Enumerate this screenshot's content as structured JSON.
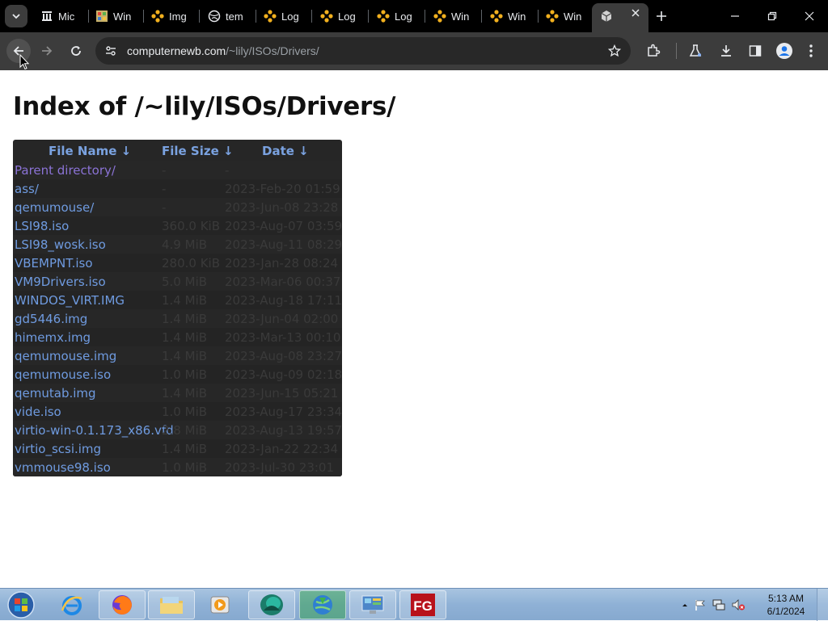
{
  "browser": {
    "tabs": [
      {
        "label": "Mic",
        "icon": "microsoft-columns-icon"
      },
      {
        "label": "Win",
        "icon": "windows-flag-icon"
      },
      {
        "label": "Img",
        "icon": "flower-icon"
      },
      {
        "label": "tem",
        "icon": "globe-icon"
      },
      {
        "label": "Log",
        "icon": "flower-icon"
      },
      {
        "label": "Log",
        "icon": "flower-icon"
      },
      {
        "label": "Log",
        "icon": "flower-icon"
      },
      {
        "label": "Win",
        "icon": "flower-icon"
      },
      {
        "label": "Win",
        "icon": "flower-icon"
      },
      {
        "label": "Win",
        "icon": "flower-icon"
      }
    ],
    "active_tab_icon": "cube-icon",
    "url_host": "computernewb.com",
    "url_path": "/~lily/ISOs/Drivers/"
  },
  "page": {
    "title": "Index of /~lily/ISOs/Drivers/",
    "columns": {
      "name": "File Name  ↓",
      "size": "File Size  ↓",
      "date": "Date  ↓"
    },
    "files": [
      {
        "name": "Parent directory/",
        "size": "-",
        "date": "-"
      },
      {
        "name": "ass/",
        "size": "-",
        "date": "2023-Feb-20 01:59"
      },
      {
        "name": "qemumouse/",
        "size": "-",
        "date": "2023-Jun-08 23:28"
      },
      {
        "name": "LSI98.iso",
        "size": "360.0 KiB",
        "date": "2023-Aug-07 03:59"
      },
      {
        "name": "LSI98_wosk.iso",
        "size": "4.9 MiB",
        "date": "2023-Aug-11 08:29"
      },
      {
        "name": "VBEMPNT.iso",
        "size": "280.0 KiB",
        "date": "2023-Jan-28 08:24"
      },
      {
        "name": "VM9Drivers.iso",
        "size": "5.0 MiB",
        "date": "2023-Mar-06 00:37"
      },
      {
        "name": "WINDOS_VIRT.IMG",
        "size": "1.4 MiB",
        "date": "2023-Aug-18 17:11"
      },
      {
        "name": "gd5446.img",
        "size": "1.4 MiB",
        "date": "2023-Jun-04 02:00"
      },
      {
        "name": "himemx.img",
        "size": "1.4 MiB",
        "date": "2023-Mar-13 00:10"
      },
      {
        "name": "qemumouse.img",
        "size": "1.4 MiB",
        "date": "2023-Aug-08 23:27"
      },
      {
        "name": "qemumouse.iso",
        "size": "1.0 MiB",
        "date": "2023-Aug-09 02:18"
      },
      {
        "name": "qemutab.img",
        "size": "1.4 MiB",
        "date": "2023-Jun-15 05:21"
      },
      {
        "name": "vide.iso",
        "size": "1.0 MiB",
        "date": "2023-Aug-17 23:34"
      },
      {
        "name": "virtio-win-0.1.173_x86.vfd",
        "size": "2.8 MiB",
        "date": "2023-Aug-13 19:57"
      },
      {
        "name": "virtio_scsi.img",
        "size": "1.4 MiB",
        "date": "2023-Jan-22 22:34"
      },
      {
        "name": "vmmouse98.iso",
        "size": "1.0 MiB",
        "date": "2023-Jul-30 23:01"
      }
    ]
  },
  "taskbar": {
    "apps": [
      {
        "icon": "internet-explorer-icon",
        "pinned": false
      },
      {
        "icon": "firefox-icon",
        "pinned": true
      },
      {
        "icon": "file-explorer-icon",
        "pinned": true
      },
      {
        "icon": "media-player-icon",
        "pinned": false
      },
      {
        "icon": "teal-app-icon",
        "pinned": true
      },
      {
        "icon": "globe-download-icon",
        "pinned": true
      },
      {
        "icon": "control-panel-icon",
        "pinned": true
      },
      {
        "icon": "fg-app-icon",
        "pinned": true
      }
    ],
    "time": "5:13 AM",
    "date": "6/1/2024"
  },
  "colors": {
    "listing_bg": "#262626",
    "link": "#6f9be0",
    "visited_link": "#8b73d6",
    "header_link": "#7aa2e0"
  }
}
